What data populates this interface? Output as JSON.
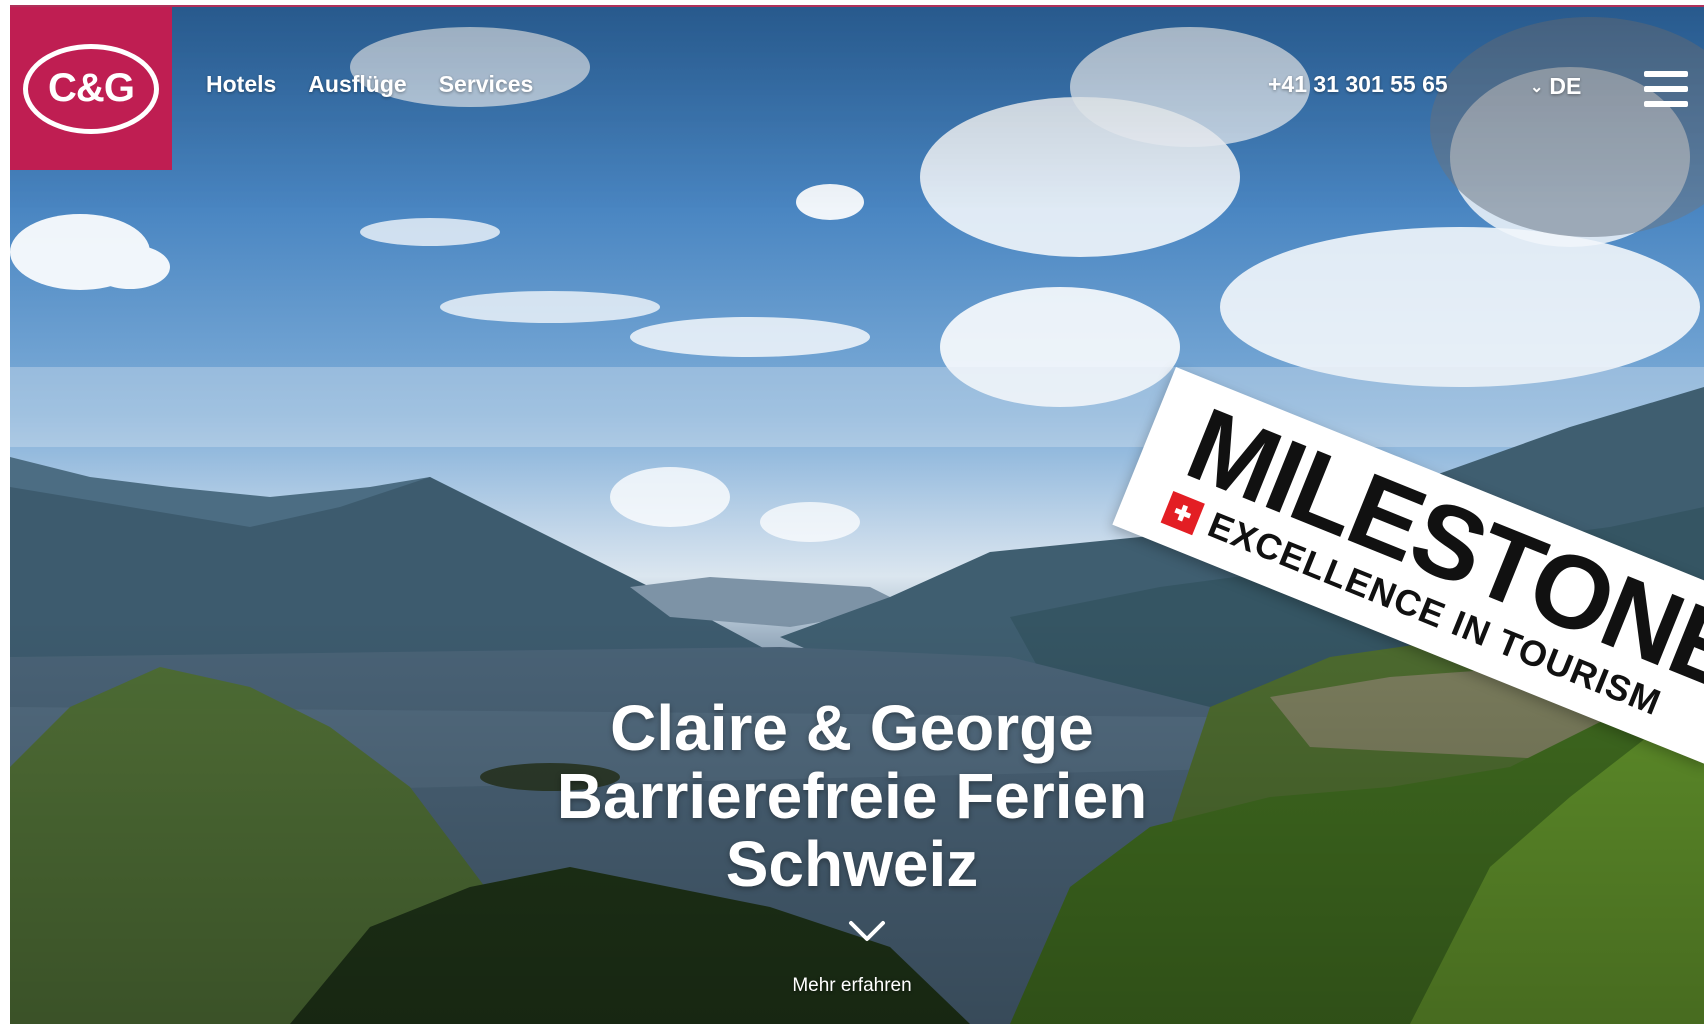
{
  "header": {
    "logo_text": "C&G",
    "nav": [
      {
        "label": "Hotels"
      },
      {
        "label": "Ausflüge"
      },
      {
        "label": "Services"
      }
    ],
    "phone": "+41 31 301 55 65",
    "language": "DE"
  },
  "hero": {
    "line1": "Claire & George",
    "line2": "Barrierefreie Ferien",
    "line3": "Schweiz",
    "more_label": "Mehr erfahren"
  },
  "badge": {
    "title": "MILESTONE",
    "subtitle": "EXCELLENCE IN TOURISM"
  },
  "colors": {
    "brand": "#bf1e52",
    "text_light": "#ffffff"
  },
  "icons": {
    "menu": "hamburger-icon",
    "language_toggle": "chevron-down-icon",
    "scroll_down": "chevron-down-icon",
    "badge_flag": "swiss-flag-icon"
  }
}
